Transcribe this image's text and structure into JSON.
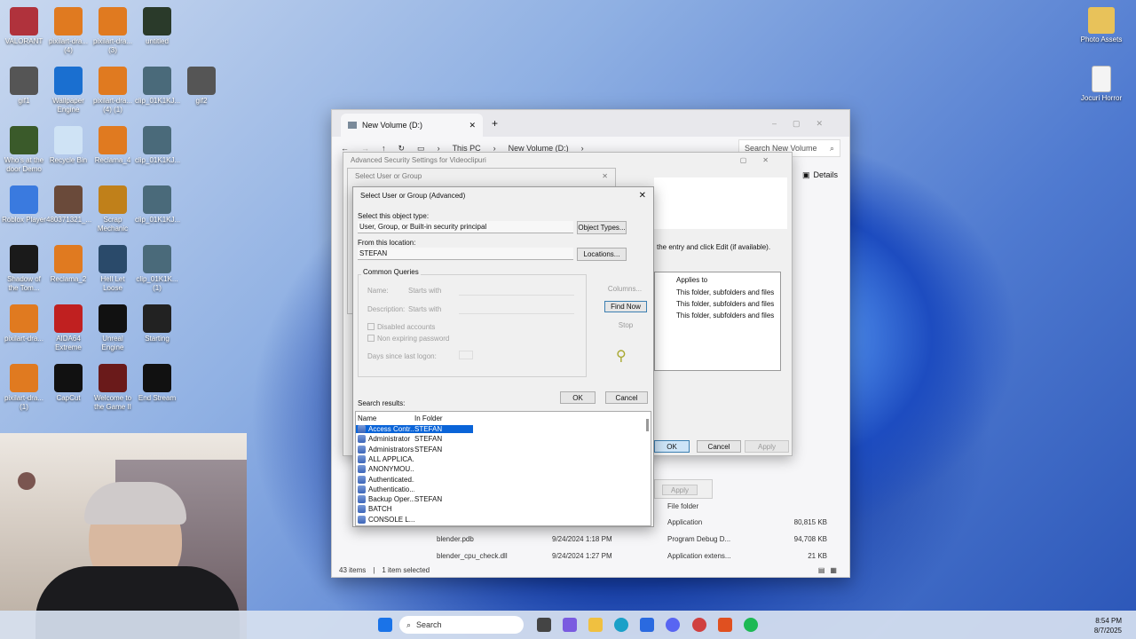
{
  "desktop_left": [
    {
      "label": "VALORANT",
      "c": "#b0323c"
    },
    {
      "label": "pixilart-dra... (4)",
      "c": "#e07a20"
    },
    {
      "label": "pixilart-dra... (3)",
      "c": "#e07a20"
    },
    {
      "label": "untitled",
      "c": "#2a3a2a"
    },
    {
      "label": "gif1",
      "c": "#555"
    },
    {
      "label": "Wallpaper Engine",
      "c": "#1a6fd0"
    },
    {
      "label": "pixilart-dra... (4) (1)",
      "c": "#e07a20"
    },
    {
      "label": "clip_01K1KJ...",
      "c": "#4a6a7a"
    },
    {
      "label": "gif2",
      "c": "#555"
    },
    {
      "label": "Who's at the door Demo",
      "c": "#3a5a2a"
    },
    {
      "label": "Recycle Bin",
      "c": "#cfe3f5"
    },
    {
      "label": "Reclama_4",
      "c": "#e07a20"
    },
    {
      "label": "clip_01K1KJ...",
      "c": "#4a6a7a"
    },
    {
      "label": "Roblox Player",
      "c": "#3a7adf"
    },
    {
      "label": "480371321_...",
      "c": "#6a4a3a"
    },
    {
      "label": "Scrap Mechanic",
      "c": "#c0801a"
    },
    {
      "label": "clip_01K1KJ...",
      "c": "#4a6a7a"
    },
    {
      "label": "Shadow of the Tom...",
      "c": "#1a1a1a"
    },
    {
      "label": "Reclama_2",
      "c": "#e07a20"
    },
    {
      "label": "Hell Let Loose",
      "c": "#2a4a6a"
    },
    {
      "label": "clip_01K1K... (1)",
      "c": "#4a6a7a"
    },
    {
      "label": "pixilart-dra...",
      "c": "#e07a20"
    },
    {
      "label": "AIDA64 Extreme",
      "c": "#c02020"
    },
    {
      "label": "Unreal Engine",
      "c": "#111"
    },
    {
      "label": "Starting",
      "c": "#222"
    },
    {
      "label": "pixilart-dra... (1)",
      "c": "#e07a20"
    },
    {
      "label": "CapCut",
      "c": "#111"
    },
    {
      "label": "Welcome to the Game II",
      "c": "#6a1a1a"
    },
    {
      "label": "End Stream",
      "c": "#111"
    }
  ],
  "desktop_right": [
    {
      "label": "Photo Assets"
    },
    {
      "label": "Jocuri Horror"
    }
  ],
  "explorer": {
    "tab_title": "New Volume (D:)",
    "new_tab": "+",
    "close": "✕",
    "breadcrumb": [
      "This PC",
      "New Volume (D:)"
    ],
    "search_placeholder": "Search New Volume",
    "details_label": "Details",
    "status_items": "43 items",
    "status_selected": "1 item selected",
    "files": [
      {
        "name": "",
        "date": "",
        "type": "File folder",
        "size": ""
      },
      {
        "name": "",
        "date": "",
        "type": "Application",
        "size": "80,815 KB"
      },
      {
        "name": "blender.pdb",
        "date": "9/24/2024 1:18 PM",
        "type": "Program Debug D...",
        "size": "94,708 KB"
      },
      {
        "name": "blender_cpu_check.dll",
        "date": "9/24/2024 1:27 PM",
        "type": "Application extens...",
        "size": "21 KB"
      }
    ]
  },
  "advanced": {
    "title": "Advanced Security Settings for Videoclipuri",
    "hint": "the entry and click Edit (if available).",
    "applies_header": "Applies to",
    "applies": [
      "This folder, subfolders and files",
      "This folder, subfolders and files",
      "This folder, subfolders and files"
    ],
    "ok": "OK",
    "cancel": "Cancel",
    "apply": "Apply",
    "apply2": "Apply"
  },
  "select_basic": {
    "title": "Select User or Group"
  },
  "select_adv": {
    "title": "Select User or Group (Advanced)",
    "object_type_label": "Select this object type:",
    "object_type_value": "User, Group, or Built-in security principal",
    "object_types_btn": "Object Types...",
    "location_label": "From this location:",
    "location_value": "STEFAN",
    "locations_btn": "Locations...",
    "common_queries_tab": "Common Queries",
    "name_label": "Name:",
    "name_mode": "Starts with",
    "desc_label": "Description:",
    "desc_mode": "Starts with",
    "disabled_accounts": "Disabled accounts",
    "non_expiring": "Non expiring password",
    "days_label": "Days since last logon:",
    "columns_btn": "Columns...",
    "find_now_btn": "Find Now",
    "stop_btn": "Stop",
    "ok_btn": "OK",
    "cancel_btn": "Cancel",
    "results_label": "Search results:",
    "col_name": "Name",
    "col_folder": "In Folder",
    "results": [
      {
        "name": "Access Contr...",
        "folder": "STEFAN"
      },
      {
        "name": "Administrator",
        "folder": "STEFAN"
      },
      {
        "name": "Administrators",
        "folder": "STEFAN"
      },
      {
        "name": "ALL APPLICA...",
        "folder": ""
      },
      {
        "name": "ANONYMOU...",
        "folder": ""
      },
      {
        "name": "Authenticated...",
        "folder": ""
      },
      {
        "name": "Authenticatio...",
        "folder": ""
      },
      {
        "name": "Backup Oper...",
        "folder": "STEFAN"
      },
      {
        "name": "BATCH",
        "folder": ""
      },
      {
        "name": "CONSOLE L...",
        "folder": ""
      }
    ]
  },
  "taskbar": {
    "search": "Search",
    "time": "8:54 PM",
    "date": "8/7/2025"
  }
}
